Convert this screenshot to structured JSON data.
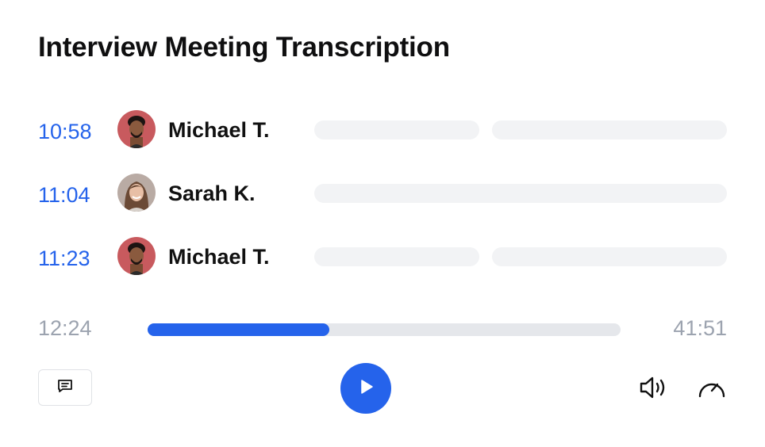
{
  "title": "Interview Meeting Transcription",
  "transcript": [
    {
      "time": "10:58",
      "speaker": "Michael T.",
      "avatar": "michael-avatar"
    },
    {
      "time": "11:04",
      "speaker": "Sarah K.",
      "avatar": "sarah-avatar"
    },
    {
      "time": "11:23",
      "speaker": "Michael T.",
      "avatar": "michael-avatar"
    }
  ],
  "player": {
    "elapsed": "12:24",
    "total": "41:51",
    "progress_fraction": 0.385
  },
  "controls": {
    "comment_icon": "comment-icon",
    "play_icon": "play-icon",
    "volume_icon": "volume-icon",
    "speed_icon": "speedometer-icon"
  },
  "colors": {
    "accent": "#2563eb",
    "placeholder_bar": "#f2f3f5",
    "muted_text": "#9ca3af",
    "track": "#e5e7eb"
  }
}
